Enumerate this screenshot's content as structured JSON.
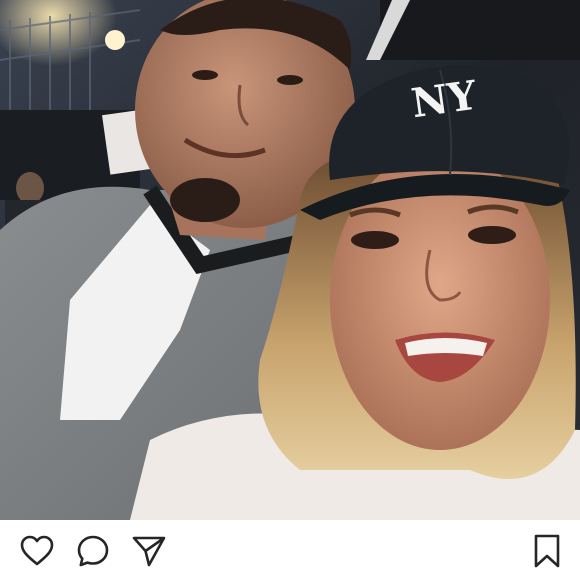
{
  "post": {
    "photo": {
      "subject": "selfie-two-people",
      "cap_logo": "NY"
    },
    "actions": {
      "like_icon": "heart-icon",
      "comment_icon": "comment-bubble-icon",
      "share_icon": "paper-plane-icon",
      "save_icon": "bookmark-icon"
    },
    "colors": {
      "icon_stroke": "#262626",
      "background": "#ffffff"
    }
  }
}
